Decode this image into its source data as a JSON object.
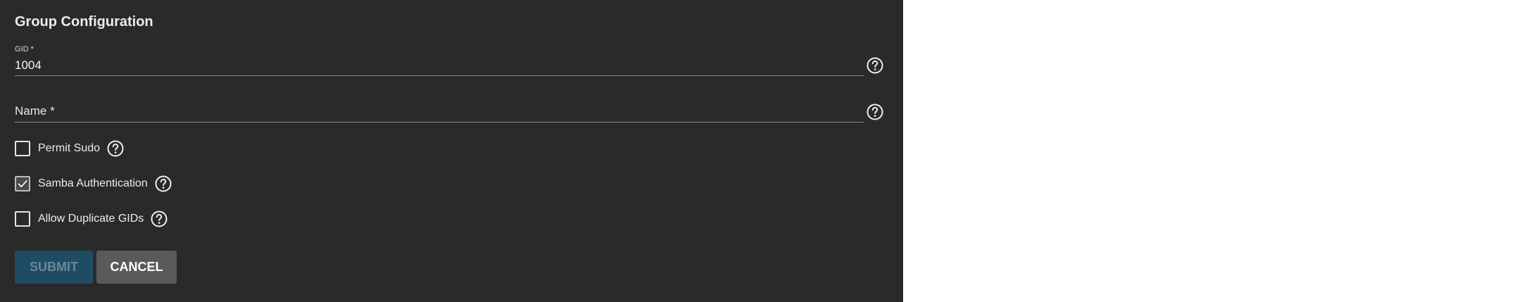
{
  "form": {
    "title": "Group Configuration",
    "gid": {
      "label": "GID *",
      "value": "1004"
    },
    "name": {
      "label": "Name *",
      "value": ""
    },
    "checkboxes": [
      {
        "label": "Permit Sudo",
        "checked": false
      },
      {
        "label": "Samba Authentication",
        "checked": true
      },
      {
        "label": "Allow Duplicate GIDs",
        "checked": false
      }
    ],
    "buttons": {
      "submit": "SUBMIT",
      "cancel": "CANCEL"
    }
  },
  "colors": {
    "panel_bg": "#2a2a2a",
    "submit_bg": "#1e4d63",
    "cancel_bg": "#5a5a5a"
  },
  "icons": {
    "help": "help-circle-icon",
    "check": "check-icon"
  }
}
